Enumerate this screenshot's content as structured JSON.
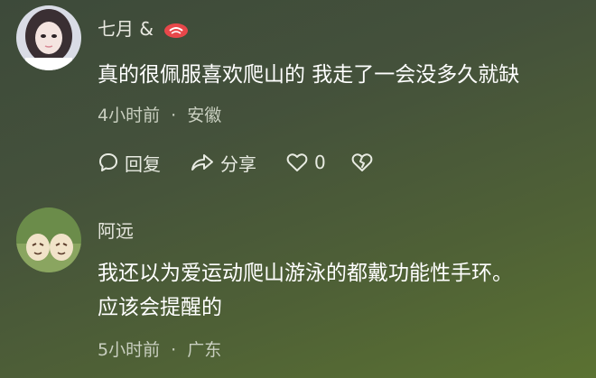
{
  "comments": [
    {
      "user": "七月 &",
      "text_lines": [
        "真的很佩服喜欢爬山的 我走了一会没多久就缺"
      ],
      "time": "4小时前",
      "location": "安徽",
      "actions": {
        "reply": "回复",
        "share": "分享",
        "likes": "0"
      }
    },
    {
      "user": "阿远",
      "text_lines": [
        "我还以为爱运动爬山游泳的都戴功能性手环。",
        "应该会提醒的"
      ],
      "time": "5小时前",
      "location": "广东"
    }
  ],
  "separator": "·",
  "colors": {
    "badge": "#e8474a"
  }
}
